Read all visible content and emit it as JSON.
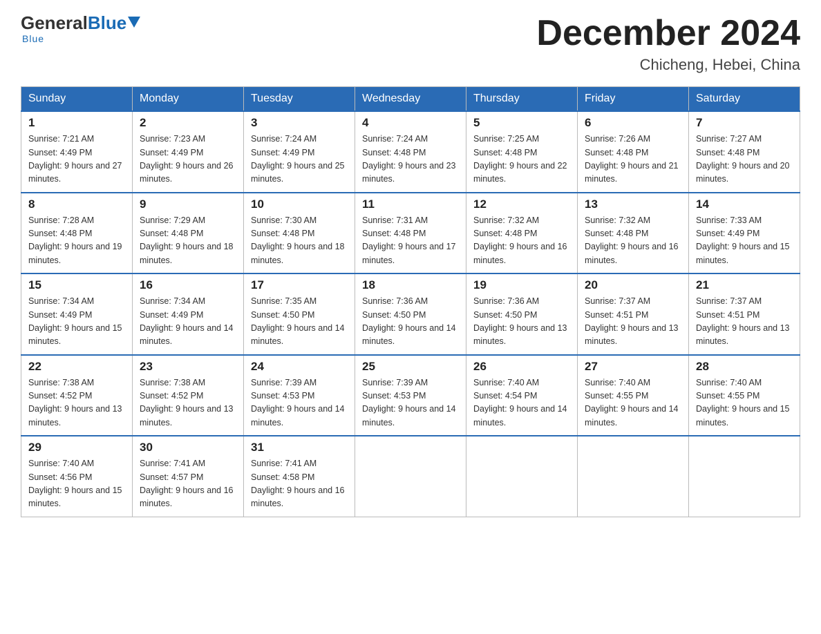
{
  "logo": {
    "general": "General",
    "blue": "Blue",
    "underline": "Blue"
  },
  "header": {
    "title": "December 2024",
    "subtitle": "Chicheng, Hebei, China"
  },
  "weekdays": [
    "Sunday",
    "Monday",
    "Tuesday",
    "Wednesday",
    "Thursday",
    "Friday",
    "Saturday"
  ],
  "weeks": [
    [
      {
        "day": "1",
        "sunrise": "Sunrise: 7:21 AM",
        "sunset": "Sunset: 4:49 PM",
        "daylight": "Daylight: 9 hours and 27 minutes."
      },
      {
        "day": "2",
        "sunrise": "Sunrise: 7:23 AM",
        "sunset": "Sunset: 4:49 PM",
        "daylight": "Daylight: 9 hours and 26 minutes."
      },
      {
        "day": "3",
        "sunrise": "Sunrise: 7:24 AM",
        "sunset": "Sunset: 4:49 PM",
        "daylight": "Daylight: 9 hours and 25 minutes."
      },
      {
        "day": "4",
        "sunrise": "Sunrise: 7:24 AM",
        "sunset": "Sunset: 4:48 PM",
        "daylight": "Daylight: 9 hours and 23 minutes."
      },
      {
        "day": "5",
        "sunrise": "Sunrise: 7:25 AM",
        "sunset": "Sunset: 4:48 PM",
        "daylight": "Daylight: 9 hours and 22 minutes."
      },
      {
        "day": "6",
        "sunrise": "Sunrise: 7:26 AM",
        "sunset": "Sunset: 4:48 PM",
        "daylight": "Daylight: 9 hours and 21 minutes."
      },
      {
        "day": "7",
        "sunrise": "Sunrise: 7:27 AM",
        "sunset": "Sunset: 4:48 PM",
        "daylight": "Daylight: 9 hours and 20 minutes."
      }
    ],
    [
      {
        "day": "8",
        "sunrise": "Sunrise: 7:28 AM",
        "sunset": "Sunset: 4:48 PM",
        "daylight": "Daylight: 9 hours and 19 minutes."
      },
      {
        "day": "9",
        "sunrise": "Sunrise: 7:29 AM",
        "sunset": "Sunset: 4:48 PM",
        "daylight": "Daylight: 9 hours and 18 minutes."
      },
      {
        "day": "10",
        "sunrise": "Sunrise: 7:30 AM",
        "sunset": "Sunset: 4:48 PM",
        "daylight": "Daylight: 9 hours and 18 minutes."
      },
      {
        "day": "11",
        "sunrise": "Sunrise: 7:31 AM",
        "sunset": "Sunset: 4:48 PM",
        "daylight": "Daylight: 9 hours and 17 minutes."
      },
      {
        "day": "12",
        "sunrise": "Sunrise: 7:32 AM",
        "sunset": "Sunset: 4:48 PM",
        "daylight": "Daylight: 9 hours and 16 minutes."
      },
      {
        "day": "13",
        "sunrise": "Sunrise: 7:32 AM",
        "sunset": "Sunset: 4:48 PM",
        "daylight": "Daylight: 9 hours and 16 minutes."
      },
      {
        "day": "14",
        "sunrise": "Sunrise: 7:33 AM",
        "sunset": "Sunset: 4:49 PM",
        "daylight": "Daylight: 9 hours and 15 minutes."
      }
    ],
    [
      {
        "day": "15",
        "sunrise": "Sunrise: 7:34 AM",
        "sunset": "Sunset: 4:49 PM",
        "daylight": "Daylight: 9 hours and 15 minutes."
      },
      {
        "day": "16",
        "sunrise": "Sunrise: 7:34 AM",
        "sunset": "Sunset: 4:49 PM",
        "daylight": "Daylight: 9 hours and 14 minutes."
      },
      {
        "day": "17",
        "sunrise": "Sunrise: 7:35 AM",
        "sunset": "Sunset: 4:50 PM",
        "daylight": "Daylight: 9 hours and 14 minutes."
      },
      {
        "day": "18",
        "sunrise": "Sunrise: 7:36 AM",
        "sunset": "Sunset: 4:50 PM",
        "daylight": "Daylight: 9 hours and 14 minutes."
      },
      {
        "day": "19",
        "sunrise": "Sunrise: 7:36 AM",
        "sunset": "Sunset: 4:50 PM",
        "daylight": "Daylight: 9 hours and 13 minutes."
      },
      {
        "day": "20",
        "sunrise": "Sunrise: 7:37 AM",
        "sunset": "Sunset: 4:51 PM",
        "daylight": "Daylight: 9 hours and 13 minutes."
      },
      {
        "day": "21",
        "sunrise": "Sunrise: 7:37 AM",
        "sunset": "Sunset: 4:51 PM",
        "daylight": "Daylight: 9 hours and 13 minutes."
      }
    ],
    [
      {
        "day": "22",
        "sunrise": "Sunrise: 7:38 AM",
        "sunset": "Sunset: 4:52 PM",
        "daylight": "Daylight: 9 hours and 13 minutes."
      },
      {
        "day": "23",
        "sunrise": "Sunrise: 7:38 AM",
        "sunset": "Sunset: 4:52 PM",
        "daylight": "Daylight: 9 hours and 13 minutes."
      },
      {
        "day": "24",
        "sunrise": "Sunrise: 7:39 AM",
        "sunset": "Sunset: 4:53 PM",
        "daylight": "Daylight: 9 hours and 14 minutes."
      },
      {
        "day": "25",
        "sunrise": "Sunrise: 7:39 AM",
        "sunset": "Sunset: 4:53 PM",
        "daylight": "Daylight: 9 hours and 14 minutes."
      },
      {
        "day": "26",
        "sunrise": "Sunrise: 7:40 AM",
        "sunset": "Sunset: 4:54 PM",
        "daylight": "Daylight: 9 hours and 14 minutes."
      },
      {
        "day": "27",
        "sunrise": "Sunrise: 7:40 AM",
        "sunset": "Sunset: 4:55 PM",
        "daylight": "Daylight: 9 hours and 14 minutes."
      },
      {
        "day": "28",
        "sunrise": "Sunrise: 7:40 AM",
        "sunset": "Sunset: 4:55 PM",
        "daylight": "Daylight: 9 hours and 15 minutes."
      }
    ],
    [
      {
        "day": "29",
        "sunrise": "Sunrise: 7:40 AM",
        "sunset": "Sunset: 4:56 PM",
        "daylight": "Daylight: 9 hours and 15 minutes."
      },
      {
        "day": "30",
        "sunrise": "Sunrise: 7:41 AM",
        "sunset": "Sunset: 4:57 PM",
        "daylight": "Daylight: 9 hours and 16 minutes."
      },
      {
        "day": "31",
        "sunrise": "Sunrise: 7:41 AM",
        "sunset": "Sunset: 4:58 PM",
        "daylight": "Daylight: 9 hours and 16 minutes."
      },
      null,
      null,
      null,
      null
    ]
  ]
}
